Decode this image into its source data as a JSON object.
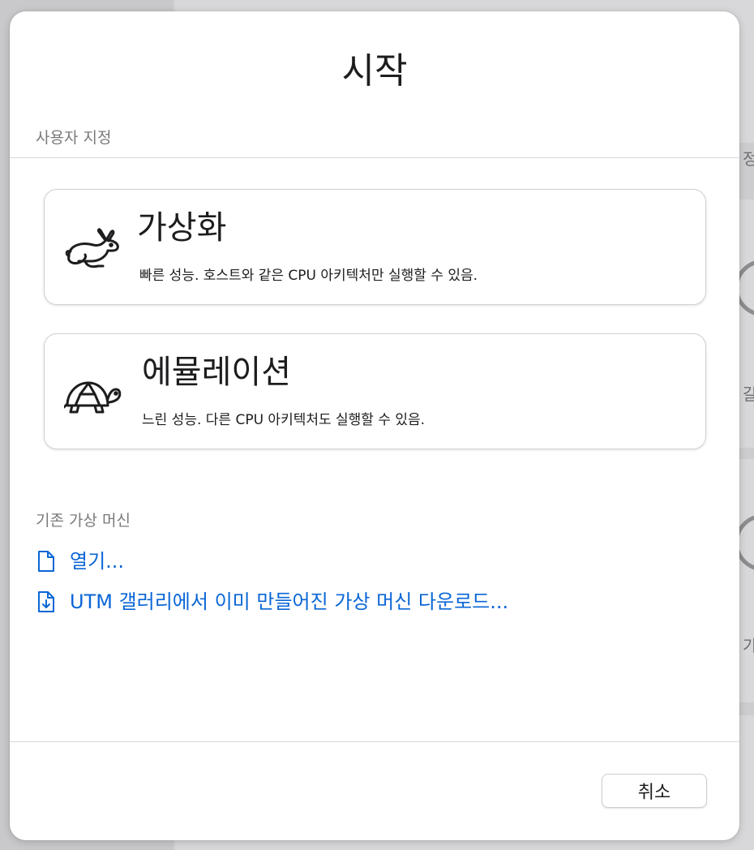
{
  "sheet": {
    "title": "시작"
  },
  "custom_section": {
    "header": "사용자 지정",
    "options": [
      {
        "title": "가상화",
        "description": "빠른 성능. 호스트와 같은 CPU 아키텍처만 실행할 수 있음.",
        "icon": "rabbit-icon"
      },
      {
        "title": "에뮬레이션",
        "description": "느린 성능. 다른 CPU 아키텍처도 실행할 수 있음.",
        "icon": "turtle-icon"
      }
    ]
  },
  "existing_section": {
    "header": "기존 가상 머신",
    "links": [
      {
        "label": "열기...",
        "icon": "document-icon"
      },
      {
        "label": "UTM 갤러리에서 이미 만들어진 가상 머신 다운로드...",
        "icon": "document-download-icon"
      }
    ]
  },
  "footer": {
    "cancel_label": "취소"
  },
  "background": {
    "glyphs": [
      "정",
      "갈",
      "가"
    ]
  },
  "colors": {
    "link": "#0a66d6",
    "text": "#1d1d1f",
    "section_header": "#7a7a7c"
  }
}
